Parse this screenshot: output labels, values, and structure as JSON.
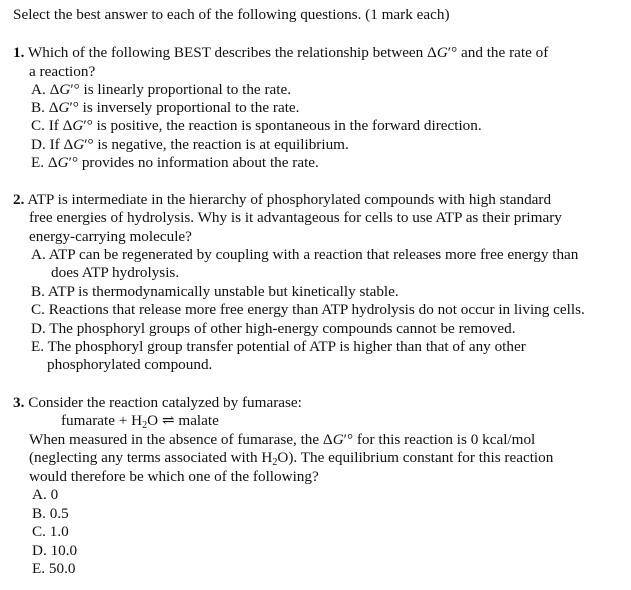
{
  "instructions": "Select the best answer to each of the following questions. (1 mark each)",
  "questions": [
    {
      "number": "1.",
      "stem_lines": [
        "Which of the following BEST describes the relationship between ΔG′° and the rate of",
        "a reaction?"
      ],
      "options": [
        {
          "letter": "A.",
          "text": "ΔG′° is linearly proportional to the rate."
        },
        {
          "letter": "B.",
          "text": "ΔG′° is inversely proportional to the rate."
        },
        {
          "letter": "C.",
          "text": "If ΔG′° is positive, the reaction is spontaneous in the forward direction."
        },
        {
          "letter": "D.",
          "text": "If ΔG′° is negative, the reaction is at equilibrium."
        },
        {
          "letter": "E.",
          "text": "ΔG′° provides no information about the rate."
        }
      ]
    },
    {
      "number": "2.",
      "stem_lines": [
        "ATP is intermediate in the hierarchy of phosphorylated compounds with high standard",
        "free energies of hydrolysis. Why is it advantageous for cells to use ATP as their primary",
        "energy-carrying molecule?"
      ],
      "options": [
        {
          "letter": "A.",
          "text": "ATP can be regenerated by coupling with a reaction that releases more free energy than",
          "cont": "does ATP hydrolysis."
        },
        {
          "letter": "B.",
          "text": "ATP is thermodynamically unstable but kinetically stable."
        },
        {
          "letter": "C.",
          "text": "Reactions that release more free energy than ATP hydrolysis do not occur in living cells."
        },
        {
          "letter": "D.",
          "text": "The phosphoryl groups of other high-energy compounds cannot be removed."
        },
        {
          "letter": "E.",
          "text": "The phosphoryl group transfer potential of ATP is higher than that of any other",
          "cont": "phosphorylated compound."
        }
      ]
    },
    {
      "number": "3.",
      "stem_lines": [
        "Consider the reaction catalyzed by fumarase:"
      ],
      "equation": {
        "left": "fumarate + H",
        "sub": "2",
        "right": "O ⇌ malate"
      },
      "body_lines": [
        "When measured in the absence of fumarase, the ΔG′° for this reaction is 0 kcal/mol",
        {
          "pre": "(neglecting any terms associated with H",
          "sub": "2",
          "post": "O). The equilibrium constant for this reaction"
        },
        "would therefore be which one of the following?"
      ],
      "options": [
        {
          "letter": "A.",
          "text": "0"
        },
        {
          "letter": "B.",
          "text": "0.5"
        },
        {
          "letter": "C.",
          "text": "1.0"
        },
        {
          "letter": "D.",
          "text": "10.0"
        },
        {
          "letter": "E.",
          "text": "50.0"
        }
      ]
    }
  ]
}
